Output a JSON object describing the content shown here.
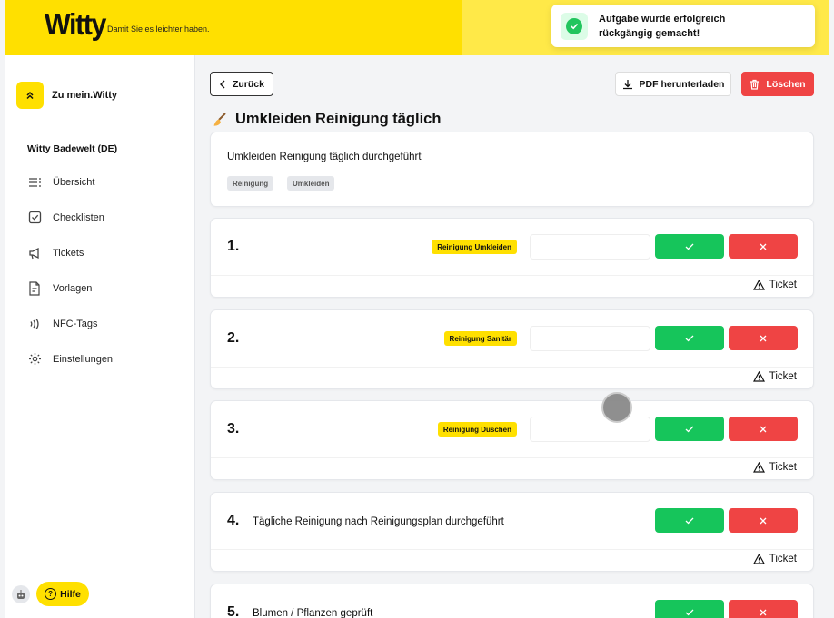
{
  "header": {
    "logo": "Witty",
    "tagline": "Damit Sie es leichter haben."
  },
  "toast": {
    "message": "Aufgabe wurde erfolgreich rückgängig gemacht!"
  },
  "sidebar": {
    "back_label": "Zu mein.Witty",
    "org_name": "Witty Badewelt (DE)",
    "items": [
      {
        "label": "Übersicht",
        "icon": "list-icon"
      },
      {
        "label": "Checklisten",
        "icon": "checklist-icon"
      },
      {
        "label": "Tickets",
        "icon": "megaphone-icon"
      },
      {
        "label": "Vorlagen",
        "icon": "template-icon"
      },
      {
        "label": "NFC-Tags",
        "icon": "nfc-icon"
      },
      {
        "label": "Einstellungen",
        "icon": "gear-icon"
      }
    ],
    "help_label": "Hilfe"
  },
  "toolbar": {
    "back": "Zurück",
    "pdf": "PDF herunterladen",
    "delete": "Löschen"
  },
  "checklist": {
    "title": "Umkleiden Reinigung täglich",
    "description": "Umkleiden Reinigung täglich durchgeführt",
    "tags": [
      "Reinigung",
      "Umkleiden"
    ]
  },
  "tasks": [
    {
      "number": "1.",
      "text": "",
      "badge": "Reinigung Umkleiden",
      "ticket": "Ticket"
    },
    {
      "number": "2.",
      "text": "",
      "badge": "Reinigung Sanitär",
      "ticket": "Ticket"
    },
    {
      "number": "3.",
      "text": "",
      "badge": "Reinigung Duschen",
      "ticket": "Ticket"
    },
    {
      "number": "4.",
      "text": "Tägliche Reinigung nach Reinigungsplan durchgeführt",
      "badge": "",
      "ticket": "Ticket"
    },
    {
      "number": "5.",
      "text": "Blumen / Pflanzen geprüft",
      "badge": "",
      "ticket": ""
    }
  ],
  "colors": {
    "brand_yellow": "#FFE000",
    "success": "#16C55B",
    "danger": "#EF4444"
  }
}
